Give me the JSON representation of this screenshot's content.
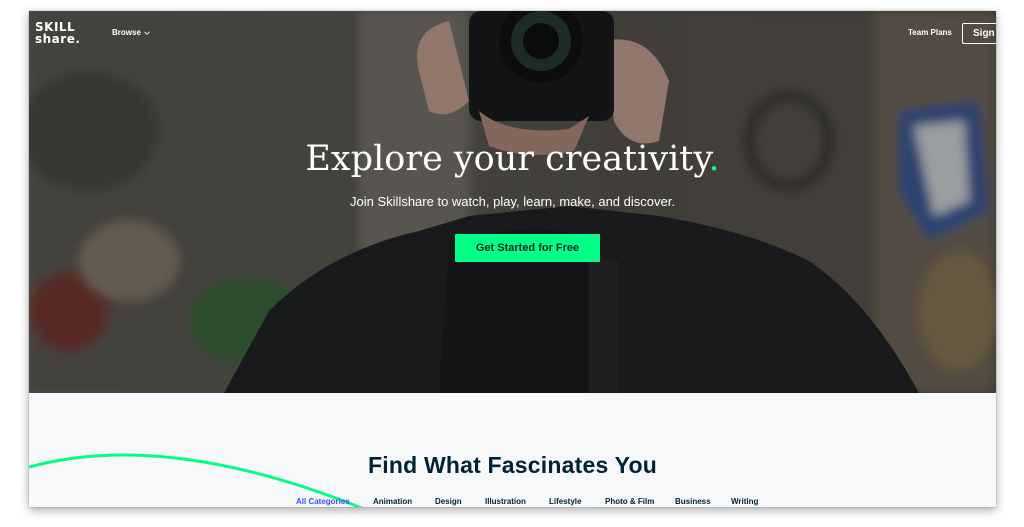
{
  "nav": {
    "logo_line1": "SKILL",
    "logo_line2": "share.",
    "browse_label": "Browse",
    "team_plans_label": "Team Plans",
    "signin_label": "Sign"
  },
  "hero": {
    "title": "Explore your creativity",
    "title_dot": ".",
    "subtitle": "Join Skillshare to watch, play, learn, make, and discover.",
    "cta_label": "Get Started for Free"
  },
  "section": {
    "title": "Find What Fascinates You",
    "categories": [
      "All Categories",
      "Animation",
      "Design",
      "Illustration",
      "Lifestyle",
      "Photo & Film",
      "Business",
      "Writing"
    ],
    "active_category": "All Categories"
  },
  "colors": {
    "accent_green": "#00ff84",
    "navy": "#002333",
    "active_tab_blue": "#394dff"
  },
  "icons": {
    "browse_chevron": "chevron-down-icon"
  }
}
